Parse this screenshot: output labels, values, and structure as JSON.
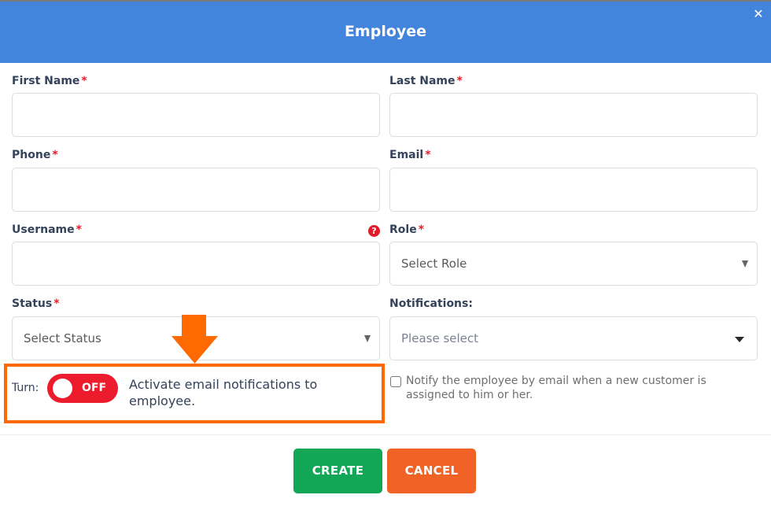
{
  "dialog": {
    "title": "Employee",
    "close_icon": "close-icon",
    "header_color": "#4384dc"
  },
  "form": {
    "first_name": {
      "label": "First Name",
      "required_mark": "*",
      "value": "",
      "placeholder": ""
    },
    "last_name": {
      "label": "Last Name",
      "required_mark": "*",
      "value": "",
      "placeholder": ""
    },
    "phone": {
      "label": "Phone",
      "required_mark": "*",
      "value": "",
      "placeholder": ""
    },
    "email": {
      "label": "Email",
      "required_mark": "*",
      "value": "",
      "placeholder": ""
    },
    "username": {
      "label": "Username",
      "required_mark": "*",
      "value": "",
      "placeholder": "",
      "help_icon": "question-circle-icon",
      "help_glyph": "?"
    },
    "role": {
      "label": "Role",
      "required_mark": "*",
      "selected": "Select Role"
    },
    "status": {
      "label": "Status",
      "required_mark": "*",
      "selected": "Select Status"
    },
    "notifications": {
      "label": "Notifications:",
      "selected": "Please select"
    }
  },
  "email_toggle": {
    "prefix_label": "Turn:",
    "state": "OFF",
    "description": "Activate email notifications to employee.",
    "color": "#ec1c2c"
  },
  "notify_checkbox": {
    "checked": false,
    "label": "Notify the employee by email when a new customer is assigned to him or her."
  },
  "annotation": {
    "highlight_color": "#ff6a00",
    "arrow_icon": "arrow-down-icon"
  },
  "footer": {
    "create_label": "CREATE",
    "cancel_label": "CANCEL",
    "create_color": "#12a757",
    "cancel_color": "#f06225"
  }
}
